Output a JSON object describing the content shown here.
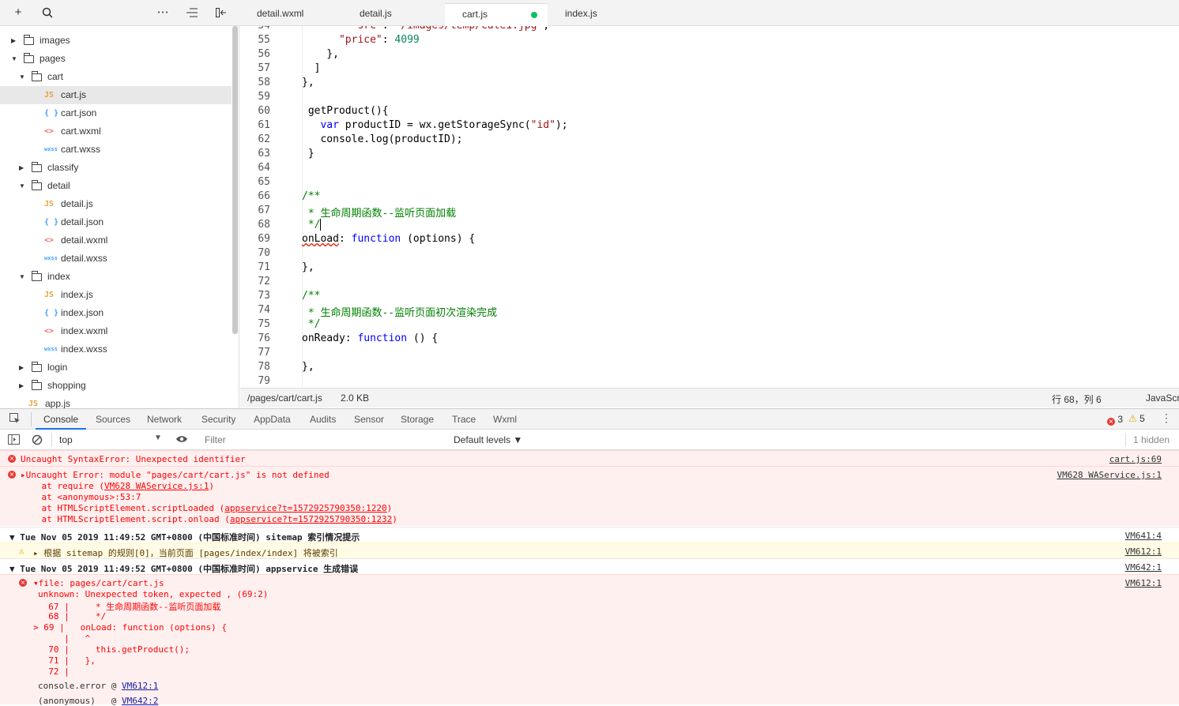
{
  "toolbar": {
    "icons": [
      "plus-icon",
      "search-icon",
      "more-icon",
      "outdent-icon",
      "collapse-sidebar-icon"
    ]
  },
  "tabs": [
    {
      "label": "detail.wxml"
    },
    {
      "label": "detail.js"
    },
    {
      "label": "cart.js"
    },
    {
      "label": "index.js"
    }
  ],
  "tree": [
    {
      "label": "images"
    },
    {
      "label": "pages"
    },
    {
      "label": "cart"
    },
    {
      "label": "cart.js",
      "icon": "JS"
    },
    {
      "label": "cart.json",
      "icon": "{ }"
    },
    {
      "label": "cart.wxml",
      "icon": "<>"
    },
    {
      "label": "cart.wxss",
      "icon": "wxss"
    },
    {
      "label": "classify"
    },
    {
      "label": "detail"
    },
    {
      "label": "detail.js",
      "icon": "JS"
    },
    {
      "label": "detail.json",
      "icon": "{ }"
    },
    {
      "label": "detail.wxml",
      "icon": "<>"
    },
    {
      "label": "detail.wxss",
      "icon": "wxss"
    },
    {
      "label": "index"
    },
    {
      "label": "index.js",
      "icon": "JS"
    },
    {
      "label": "index.json",
      "icon": "{ }"
    },
    {
      "label": "index.wxml",
      "icon": "<>"
    },
    {
      "label": "index.wxss",
      "icon": "wxss"
    },
    {
      "label": "login"
    },
    {
      "label": "shopping"
    },
    {
      "label": "app.js",
      "icon": "JS"
    }
  ],
  "editor": {
    "line_numbers": [
      "54",
      "55",
      "56",
      "57",
      "58",
      "59",
      "60",
      "61",
      "62",
      "63",
      "64",
      "65",
      "66",
      "67",
      "68",
      "69",
      "70",
      "71",
      "72",
      "73",
      "74",
      "75",
      "76",
      "77",
      "78",
      "79"
    ]
  },
  "status": {
    "path": "/pages/cart/cart.js",
    "size": "2.0 KB",
    "position": "行 68，列 6",
    "lang": "JavaScr"
  },
  "devtools": {
    "tabs": [
      "Console",
      "Sources",
      "Network",
      "Security",
      "AppData",
      "Audits",
      "Sensor",
      "Storage",
      "Trace",
      "Wxml"
    ],
    "error_count": "3",
    "warn_count": "5",
    "context": "top",
    "filter_placeholder": "Filter",
    "levels": "Default levels ▼",
    "hidden": "1 hidden"
  },
  "console": {
    "e1": {
      "text": "Uncaught SyntaxError: Unexpected identifier",
      "src": "cart.js:69"
    },
    "e2": {
      "text": "▸Uncaught Error: module \"pages/cart/cart.js\" is not defined",
      "src": "VM628 WAService.js:1",
      "l1a": "    at require (",
      "l1b": "VM628 WAService.js:1",
      "l1c": ")",
      "l2": "    at <anonymous>:53:7",
      "l3a": "    at HTMLScriptElement.scriptLoaded (",
      "l3b": "appservice?t=1572925790350:1220",
      "l3c": ")",
      "l4a": "    at HTMLScriptElement.script.onload (",
      "l4b": "appservice?t=1572925790350:1232",
      "l4c": ")"
    },
    "g1": {
      "text": "▼ Tue Nov 05 2019 11:49:52 GMT+0800 (中国标准时间) sitemap 索引情况提示",
      "src": "VM641:4"
    },
    "w1": {
      "text": "▸ 根据 sitemap 的规则[0]，当前页面 [pages/index/index] 将被索引",
      "src": "VM612:1"
    },
    "g2": {
      "text": "▼ Tue Nov 05 2019 11:49:52 GMT+0800 (中国标准时间) appservice 生成错误",
      "src": "VM642:1"
    },
    "e3": {
      "src": "VM612:1",
      "lines": [
        "▾file: pages/cart/cart.js",
        "unknown: Unexpected token, expected , (69:2)",
        "  67 |     * 生命周期函数--监听页面加载",
        "  68 |     */",
        "> 69 |   onLoad: function (options) {",
        "     |   ^",
        "  70 |     this.getProduct();",
        "  71 |   },",
        "  72 |"
      ],
      "trace1a": "console.error @ ",
      "trace1b": "VM612:1",
      "trace2a": "(anonymous)   @ ",
      "trace2b": "VM642:2"
    }
  }
}
